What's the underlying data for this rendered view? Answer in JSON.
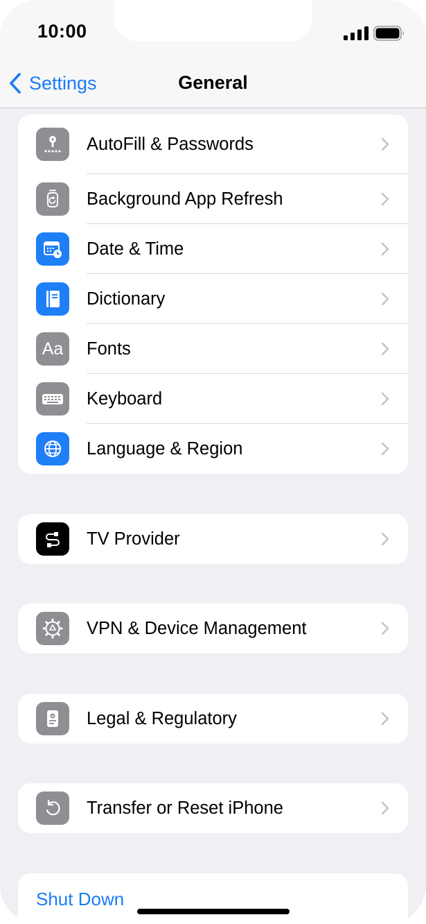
{
  "status_bar": {
    "time": "10:00"
  },
  "nav": {
    "back_label": "Settings",
    "title": "General"
  },
  "groups": [
    {
      "rows": [
        {
          "label": "AutoFill & Passwords",
          "icon": "key-icon",
          "color": "#8e8e93"
        },
        {
          "label": "Background App Refresh",
          "icon": "refresh-icon",
          "color": "#8e8e93"
        },
        {
          "label": "Date & Time",
          "icon": "calendar-clock-icon",
          "color": "#1f7ff7"
        },
        {
          "label": "Dictionary",
          "icon": "book-icon",
          "color": "#1f7ff7"
        },
        {
          "label": "Fonts",
          "icon": "fonts-icon",
          "icon_text": "Aa",
          "color": "#8e8e93"
        },
        {
          "label": "Keyboard",
          "icon": "keyboard-icon",
          "color": "#8e8e93"
        },
        {
          "label": "Language & Region",
          "icon": "globe-icon",
          "color": "#1f7ff7"
        }
      ]
    },
    {
      "rows": [
        {
          "label": "TV Provider",
          "icon": "tv-provider-icon",
          "color": "#000000"
        }
      ]
    },
    {
      "rows": [
        {
          "label": "VPN & Device Management",
          "icon": "gear-icon",
          "color": "#8e8e93"
        }
      ]
    },
    {
      "rows": [
        {
          "label": "Legal & Regulatory",
          "icon": "document-badge-icon",
          "color": "#8e8e93"
        }
      ]
    },
    {
      "rows": [
        {
          "label": "Transfer or Reset iPhone",
          "icon": "reset-icon",
          "color": "#8e8e93"
        }
      ]
    }
  ],
  "shutdown": {
    "label": "Shut Down"
  },
  "colors": {
    "accent": "#1a7cf5",
    "background": "#efeff4"
  }
}
